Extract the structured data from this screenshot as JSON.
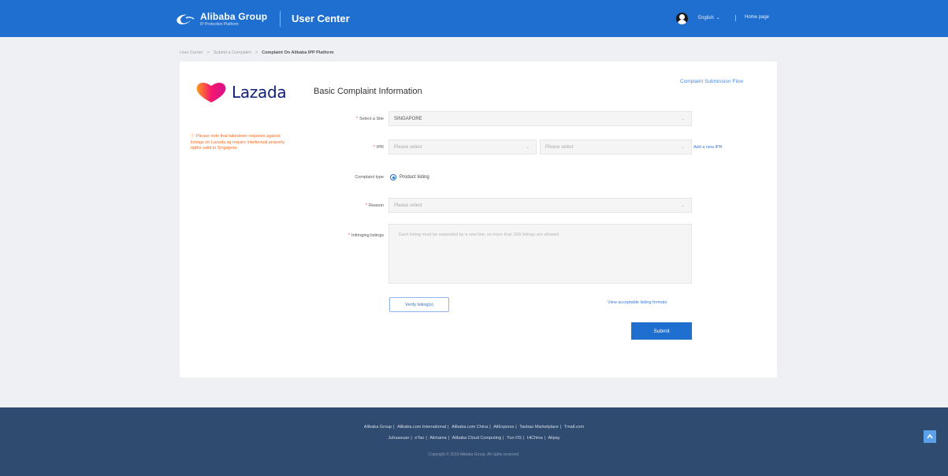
{
  "header": {
    "brand_name": "Alibaba Group",
    "brand_sub": "IP Protection Platform",
    "title": "User Center",
    "language": "English",
    "homepage": "Home page"
  },
  "breadcrumb": {
    "items": [
      "User Center",
      "Submit a Complaint",
      "Complaint On Alibaba IPP Platform"
    ]
  },
  "brand_logo": "Lazada",
  "notice": "Please note that takedown requests against listings on Lazada.sg require intellectual property rights valid in Singapore.",
  "section_title": "Basic Complaint Information",
  "flow_link": "Complaint Submission Flow",
  "form": {
    "site": {
      "label": "Select a Site",
      "value": "SINGAPORE"
    },
    "ipr": {
      "label": "IPR",
      "placeholder_1": "Please select",
      "placeholder_2": "Please select",
      "add_link": "Add a new IPR"
    },
    "complaint_type": {
      "label": "Complaint type",
      "option": "Product listing"
    },
    "reason": {
      "label": "Reason",
      "placeholder": "Please select"
    },
    "listings": {
      "label": "Infringing listings",
      "placeholder": "Each listing must be separated by a new line, no more than 200 listings are allowed"
    },
    "verify_button": "Verify listing(s)",
    "formats_link": "View acceptable listing formats",
    "submit_button": "Submit"
  },
  "footer": {
    "links_row1": [
      "Alibaba Group",
      "Alibaba.com International",
      "Alibaba.com China",
      "AliExpress",
      "Taobao Marketplace",
      "Tmall.com"
    ],
    "links_row2": [
      "Juhuasuan",
      "eTao",
      "Alimama",
      "Alibaba Cloud Computing",
      "Yun OS",
      "HiChina",
      "Alipay"
    ],
    "copyright": "Copyright © 2019 Alibaba Group. All rights reserved."
  },
  "colors": {
    "header": "#1f6fd0",
    "footer": "#2f4b6f",
    "accent": "#1f6fd0",
    "notice": "#ff6a1a",
    "lazada_blue": "#0f1f74",
    "lazada_pink": "#f5186f",
    "lazada_orange": "#ff7b1c"
  },
  "icons": {
    "brand": "alibaba-logo-icon",
    "avatar": "user-avatar-icon",
    "lang": "chevron-down-icon",
    "back_top": "back-to-top-icon"
  }
}
